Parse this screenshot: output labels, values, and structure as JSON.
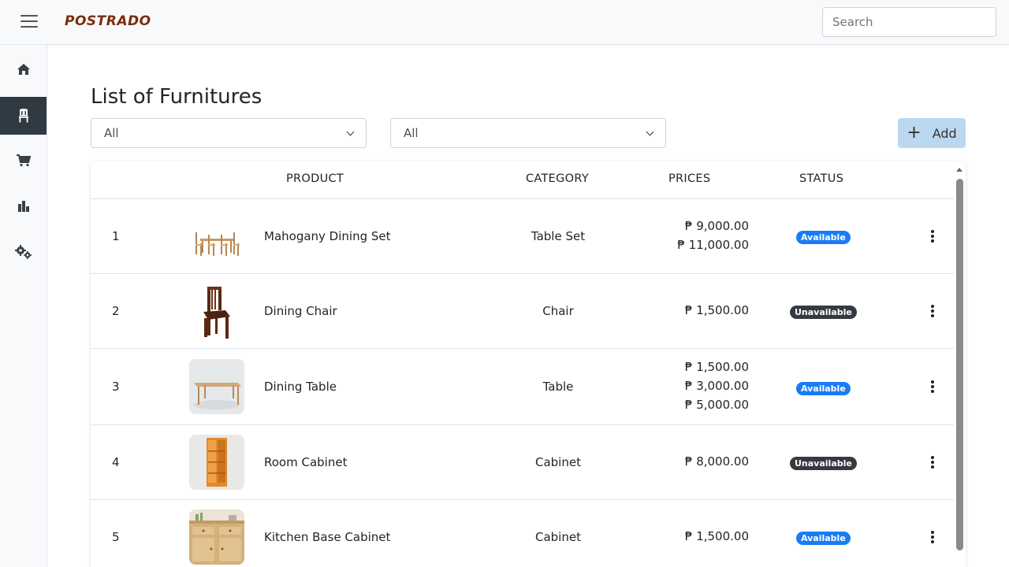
{
  "brand": "POSTRADO",
  "search": {
    "placeholder": "Search"
  },
  "sidebar": {
    "items": [
      {
        "name": "home-icon",
        "active": false
      },
      {
        "name": "chair-icon",
        "active": true
      },
      {
        "name": "cart-icon",
        "active": false
      },
      {
        "name": "bar-chart-icon",
        "active": false
      },
      {
        "name": "gears-icon",
        "active": false
      }
    ]
  },
  "page": {
    "title": "List of Furnitures"
  },
  "filters": {
    "category_value": "All",
    "status_value": "All"
  },
  "add_button": {
    "label": "Add"
  },
  "table": {
    "headers": {
      "product": "PRODUCT",
      "category": "CATEGORY",
      "prices": "PRICES",
      "status": "STATUS"
    },
    "rows": [
      {
        "index": "1",
        "name": "Mahogany Dining Set",
        "category": "Table Set",
        "prices": [
          "₱ 9,000.00",
          "₱ 11,000.00"
        ],
        "status": "Available"
      },
      {
        "index": "2",
        "name": "Dining Chair",
        "category": "Chair",
        "prices": [
          "₱ 1,500.00"
        ],
        "status": "Unavailable"
      },
      {
        "index": "3",
        "name": "Dining Table",
        "category": "Table",
        "prices": [
          "₱ 1,500.00",
          "₱ 3,000.00",
          "₱ 5,000.00"
        ],
        "status": "Available"
      },
      {
        "index": "4",
        "name": "Room Cabinet",
        "category": "Cabinet",
        "prices": [
          "₱ 8,000.00"
        ],
        "status": "Unavailable"
      },
      {
        "index": "5",
        "name": "Kitchen Base Cabinet",
        "category": "Cabinet",
        "prices": [
          "₱ 1,500.00"
        ],
        "status": "Available"
      }
    ]
  },
  "colors": {
    "brand": "#7a2e0e",
    "sidebar_active": "#2f3a42",
    "badge_available": "#1a7cf5",
    "badge_unavailable": "#343a40",
    "add_button_bg": "#bcd8f0"
  }
}
